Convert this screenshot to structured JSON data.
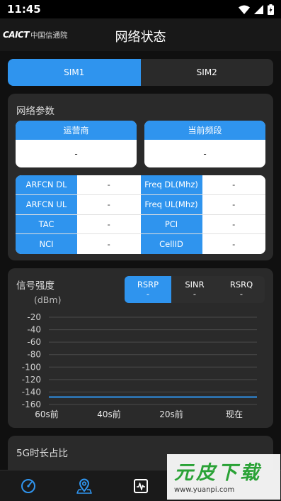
{
  "status_bar": {
    "time": "11:45"
  },
  "header": {
    "logo_latin": "CAICT",
    "logo_cn": "中国信通院",
    "title": "网络状态"
  },
  "sim_tabs": [
    {
      "label": "SIM1",
      "active": true
    },
    {
      "label": "SIM2",
      "active": false
    }
  ],
  "network_params": {
    "title": "网络参数",
    "operator": {
      "label": "运营商",
      "value": "-"
    },
    "band": {
      "label": "当前频段",
      "value": "-"
    },
    "rows": [
      {
        "k1": "ARFCN DL",
        "v1": "-",
        "k2": "Freq DL(Mhz)",
        "v2": "-"
      },
      {
        "k1": "ARFCN UL",
        "v1": "-",
        "k2": "Freq UL(Mhz)",
        "v2": "-"
      },
      {
        "k1": "TAC",
        "v1": "-",
        "k2": "PCI",
        "v2": "-"
      },
      {
        "k1": "NCI",
        "v1": "-",
        "k2": "CellID",
        "v2": "-"
      }
    ]
  },
  "signal": {
    "title": "信号强度",
    "unit": "(dBm)",
    "tabs": [
      {
        "label": "RSRP",
        "value": "-",
        "active": true
      },
      {
        "label": "SINR",
        "value": "-",
        "active": false
      },
      {
        "label": "RSRQ",
        "value": "-",
        "active": false
      }
    ]
  },
  "chart_data": {
    "type": "line",
    "title": "",
    "xlabel": "",
    "ylabel": "(dBm)",
    "yticks": [
      -20,
      -40,
      -60,
      -80,
      -100,
      -120,
      -140,
      -160
    ],
    "ylim": [
      -160,
      -20
    ],
    "xticks": [
      "60s前",
      "40s前",
      "20s前",
      "现在"
    ],
    "grid": true,
    "series": [
      {
        "values": [
          -148,
          -148,
          -148,
          -148
        ],
        "color": "#2f94ee"
      }
    ]
  },
  "section3": {
    "title": "5G时长占比"
  },
  "bottom_nav": [
    {
      "icon": "speedometer-icon",
      "active": false
    },
    {
      "icon": "map-pin-icon",
      "active": false
    },
    {
      "icon": "monitor-icon",
      "active": true
    }
  ],
  "watermark": {
    "brand": "元皮下载",
    "url": "www.yuanpi.com"
  },
  "colors": {
    "accent": "#2f94ee",
    "card": "#2a2a2a",
    "background": "#101010",
    "nav_icon": "#2f94ee"
  }
}
